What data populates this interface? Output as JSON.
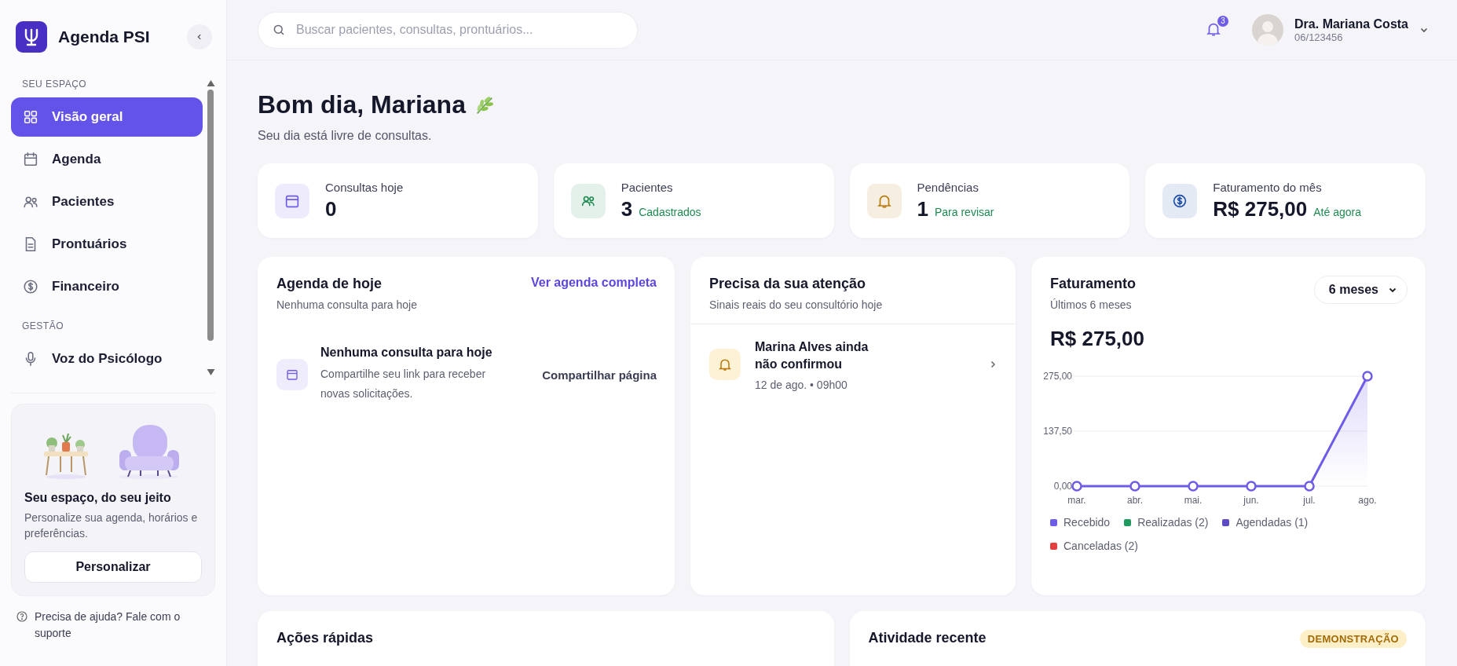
{
  "sidebar": {
    "brand": "Agenda PSI",
    "sections": [
      {
        "title": "SEU ESPAÇO",
        "items": [
          {
            "label": "Visão geral",
            "selected": true
          },
          {
            "label": "Agenda",
            "selected": false
          },
          {
            "label": "Pacientes",
            "selected": false
          },
          {
            "label": "Prontuários",
            "selected": false
          },
          {
            "label": "Financeiro",
            "selected": false
          }
        ]
      },
      {
        "title": "GESTÃO",
        "items": [
          {
            "label": "Voz do Psicólogo",
            "selected": false
          }
        ]
      }
    ],
    "promo": {
      "title": "Seu espaço, do seu jeito",
      "text": "Personalize sua agenda, horários e preferências.",
      "button": "Personalizar"
    },
    "help": "Precisa de ajuda? Fale com o suporte"
  },
  "topbar": {
    "search": {
      "placeholder": "Buscar pacientes, consultas, prontuários..."
    },
    "notifications": "3",
    "user": {
      "name": "Dra. Mariana Costa",
      "id": "06/123456"
    }
  },
  "greeting": {
    "title": "Bom dia, Mariana",
    "subtitle": "Seu dia está livre de consultas."
  },
  "stats": [
    {
      "label": "Consultas hoje",
      "value": "0",
      "color": "#6d5ce8"
    },
    {
      "label": "Pacientes",
      "value": "3",
      "note": "Cadastrados",
      "color": "#1f8a50"
    },
    {
      "label": "Pendências",
      "value": "1",
      "note": "Para revisar",
      "color": "#b9790a"
    },
    {
      "label": "Faturamento do mês",
      "value": "R$ 275,00",
      "note": "Até agora",
      "color": "#1e4fa8"
    }
  ],
  "agenda": {
    "title": "Agenda de hoje",
    "subtitle": "Nenhuma consulta para hoje",
    "link": "Ver agenda completa",
    "empty_title": "Nenhuma consulta para hoje",
    "empty_text": "Compartilhe seu link para receber novas solicitações.",
    "action": "Compartilhar página"
  },
  "attention": {
    "title": "Precisa da sua atenção",
    "subtitle": "Sinais reais do seu consultório hoje",
    "items": [
      {
        "title": "Marina Alves ainda não confirmou",
        "meta": "12 de ago. • 09h00"
      }
    ]
  },
  "revenue": {
    "title": "Faturamento",
    "subtitle": "Últimos 6 meses",
    "period": "6 meses",
    "total": "R$ 275,00",
    "chart_data": {
      "type": "line",
      "categories": [
        "mar.",
        "abr.",
        "mai.",
        "jun.",
        "jul.",
        "ago."
      ],
      "series": [
        {
          "name": "Recebido",
          "color": "#6d5ce8",
          "marker": true,
          "values": [
            0,
            0,
            0,
            0,
            0,
            275
          ]
        }
      ],
      "ylim": [
        0,
        275
      ],
      "yticks": [
        {
          "value": 0,
          "label": "0,00"
        },
        {
          "value": 137.5,
          "label": "137,50"
        },
        {
          "value": 275,
          "label": "275,00"
        }
      ]
    },
    "legend": [
      {
        "label": "Realizadas (2)",
        "color": "#1f9a5e"
      },
      {
        "label": "Agendadas (1)",
        "color": "#5b4bc4"
      },
      {
        "label": "Canceladas (2)",
        "color": "#e53e3e"
      }
    ]
  },
  "quick_actions": {
    "title": "Ações rápidas"
  },
  "activity": {
    "title": "Atividade recente",
    "badge": "DEMONSTRAÇÃO"
  }
}
